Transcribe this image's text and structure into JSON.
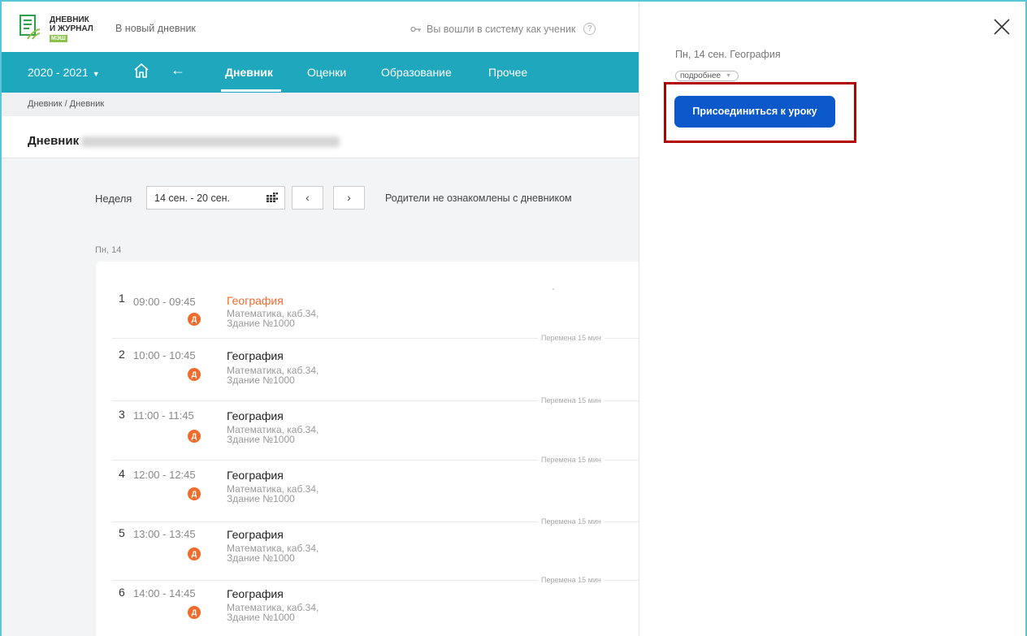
{
  "header": {
    "logo_line1": "ДНЕВНИК",
    "logo_line2": "И ЖУРНАЛ",
    "logo_badge": "МЭШ",
    "new_diary_link": "В новый дневник",
    "login_info": "Вы вошли в систему как ученик",
    "help_symbol": "?"
  },
  "nav": {
    "year": "2020 - 2021",
    "tabs": [
      "Дневник",
      "Оценки",
      "Образование",
      "Прочее"
    ],
    "home_icon": "home-icon",
    "back_icon": "arrow-left-icon"
  },
  "breadcrumb": "Дневник / Дневник",
  "page_title": "Дневник",
  "week": {
    "label": "Неделя",
    "range": "14 сен. - 20 сен.",
    "prev_symbol": "‹",
    "next_symbol": "›",
    "parents_note": "Родители не ознакомлены с дневником"
  },
  "day_label": "Пн, 14",
  "lessons": [
    {
      "num": "1",
      "time": "09:00 - 09:45",
      "badge": "Д",
      "subject": "География",
      "place_line1": "Математика, каб.34,",
      "place_line2": "Здание №1000"
    },
    {
      "num": "2",
      "time": "10:00 - 10:45",
      "badge": "Д",
      "subject": "География",
      "place_line1": "Математика, каб.34,",
      "place_line2": "Здание №1000"
    },
    {
      "num": "3",
      "time": "11:00 - 11:45",
      "badge": "Д",
      "subject": "География",
      "place_line1": "Математика, каб.34,",
      "place_line2": "Здание №1000"
    },
    {
      "num": "4",
      "time": "12:00 - 12:45",
      "badge": "Д",
      "subject": "География",
      "place_line1": "Математика, каб.34,",
      "place_line2": "Здание №1000"
    },
    {
      "num": "5",
      "time": "13:00 - 13:45",
      "badge": "Д",
      "subject": "География",
      "place_line1": "Математика, каб.34,",
      "place_line2": "Здание №1000"
    },
    {
      "num": "6",
      "time": "14:00 - 14:45",
      "badge": "Д",
      "subject": "География",
      "place_line1": "Математика, каб.34,",
      "place_line2": "Здание №1000"
    }
  ],
  "break_label": "Перемена 15 мин",
  "side_panel": {
    "title": "Пн, 14 сен. География",
    "details_label": "подробнее",
    "join_button": "Присоединиться к уроку"
  },
  "colors": {
    "accent": "#1fa7bd",
    "highlight_subject": "#f06b2c",
    "join_button": "#0a58ca",
    "annotation_box": "#b00000"
  }
}
